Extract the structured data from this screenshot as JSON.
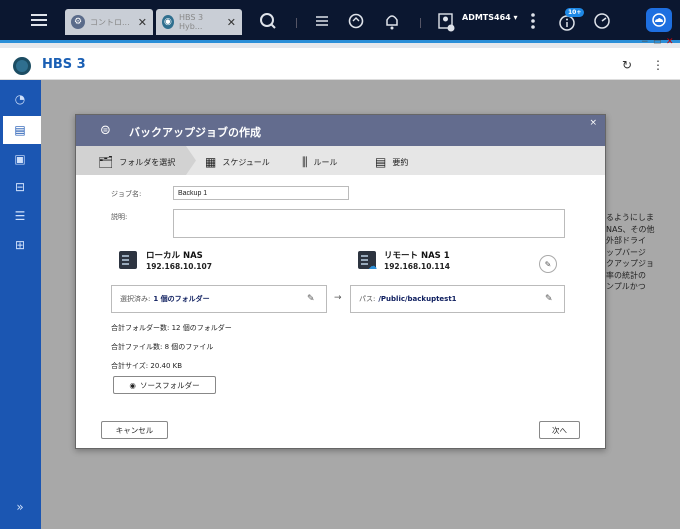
{
  "topbar": {
    "tabs": [
      {
        "label": "コントロ...",
        "close": "✕"
      },
      {
        "label": "HBS 3 Hyb...",
        "close": "✕"
      }
    ],
    "user": "ADMTS464 ▾",
    "notif_badge": "10+"
  },
  "window": {
    "controls": [
      "−",
      "▭",
      "✕"
    ]
  },
  "app": {
    "title": "HBS 3"
  },
  "background_text": [
    "きるようにしま",
    "にNAS、その他",
    "の外部ドライ",
    "アップバージ",
    "ックアップジョ",
    "用率の統計の",
    "シンプルかつ"
  ],
  "dialog": {
    "title": "バックアップジョブの作成",
    "close": "×",
    "steps": [
      "フォルダを選択",
      "スケジュール",
      "ルール",
      "要約"
    ],
    "job_name_label": "ジョブ名:",
    "job_name_value": "Backup 1",
    "description_label": "説明:",
    "local": {
      "name": "ローカル NAS",
      "ip": "192.168.10.107"
    },
    "remote": {
      "name": "リモート NAS 1",
      "ip": "192.168.10.114"
    },
    "selected_label": "選択済み:",
    "selected_value": "1 個のフォルダー",
    "arrow": "→",
    "path_label": "パス:",
    "path_value": "/Public/backuptest1",
    "stats": {
      "folders_label": "合計フォルダー数:",
      "folders_value": "12 個のフォルダー",
      "files_label": "合計ファイル数:",
      "files_value": "8 個のファイル",
      "size_label": "合計サイズ:",
      "size_value": "20.40 KB"
    },
    "source_button": "ソースフォルダー",
    "cancel_button": "キャンセル",
    "next_button": "次へ"
  }
}
